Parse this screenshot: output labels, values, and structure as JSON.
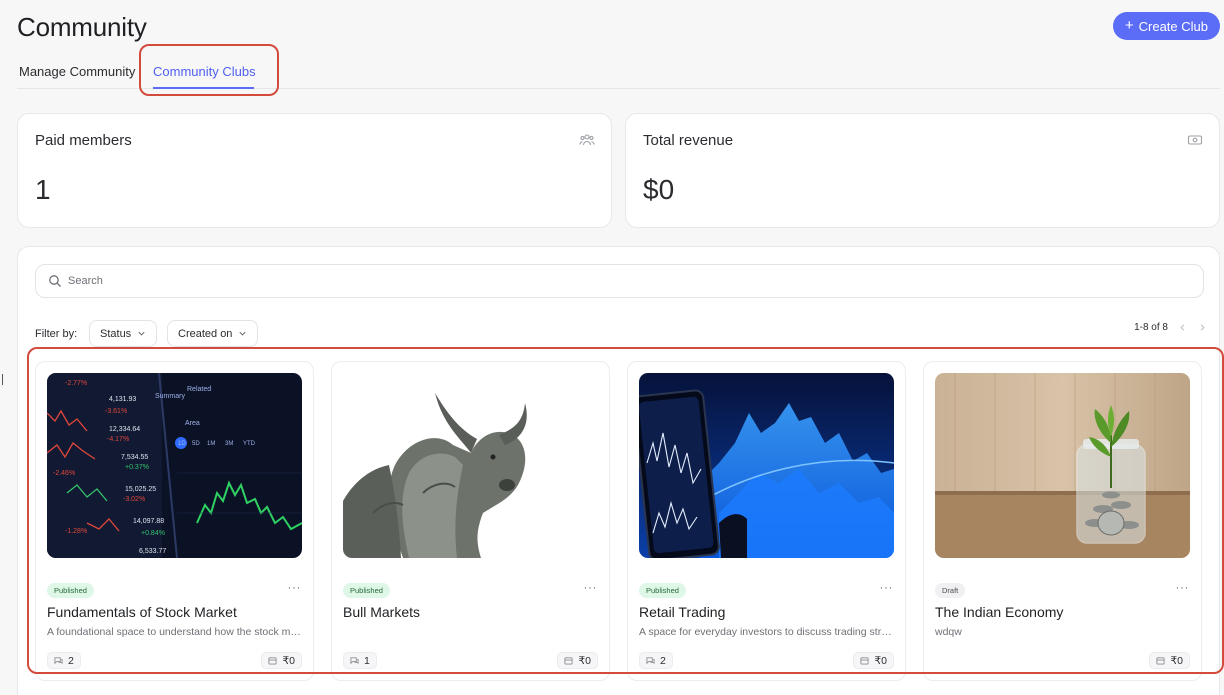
{
  "header": {
    "title": "Community",
    "create_button": "Create Club"
  },
  "tabs": [
    {
      "label": "Manage Community",
      "active": false
    },
    {
      "label": "Community Clubs",
      "active": true
    }
  ],
  "stats": [
    {
      "label": "Paid members",
      "value": "1",
      "icon": "users-icon"
    },
    {
      "label": "Total revenue",
      "value": "$0",
      "icon": "cash-icon"
    }
  ],
  "search": {
    "placeholder": "Search",
    "value": ""
  },
  "filters": {
    "label": "Filter by:",
    "status": "Status",
    "created_on": "Created on"
  },
  "pagination": {
    "text": "1-8 of 8"
  },
  "clubs": [
    {
      "status": "Published",
      "title": "Fundamentals of Stock Market",
      "description": "A foundational space to understand how the stock market works",
      "members": "2",
      "price": "₹0"
    },
    {
      "status": "Published",
      "title": "Bull Markets",
      "description": "",
      "members": "1",
      "price": "₹0"
    },
    {
      "status": "Published",
      "title": "Retail Trading",
      "description": "A space for everyday investors to discuss trading strategies",
      "members": "2",
      "price": "₹0"
    },
    {
      "status": "Draft",
      "title": "The Indian Economy",
      "description": "wdqw",
      "members": "",
      "price": "₹0"
    }
  ],
  "colors": {
    "accent": "#5b6cf6",
    "highlight": "#d24b3c",
    "published_bg": "#dff7e6",
    "draft_bg": "#f0f0f2"
  }
}
